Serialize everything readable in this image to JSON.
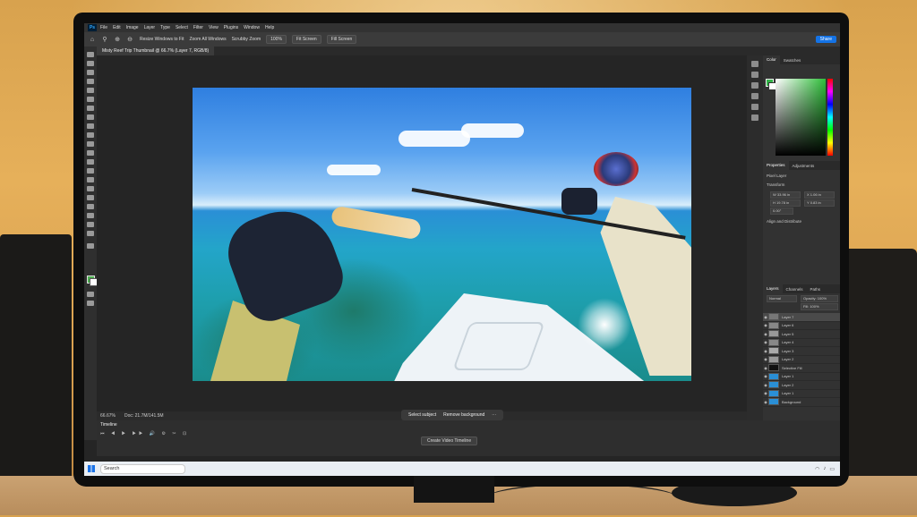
{
  "menu": {
    "logo": "Ps",
    "items": [
      "File",
      "Edit",
      "Image",
      "Layer",
      "Type",
      "Select",
      "Filter",
      "View",
      "Plugins",
      "Window",
      "Help"
    ]
  },
  "options": {
    "resize_windows": "Resize Windows to Fit",
    "zoom_all": "Zoom All Windows",
    "scrubby_zoom": "Scrubby Zoom",
    "zoom_value": "100%",
    "fit_screen": "Fit Screen",
    "fill_screen": "Fill Screen"
  },
  "document": {
    "tab_title": "Misty Reef Trip Thumbnail @ 66.7% (Layer 7, RGB/8)"
  },
  "share_button": "Share",
  "panels": {
    "color_tabs": [
      "Color",
      "Swatches"
    ],
    "properties_tabs": [
      "Properties",
      "Adjustments"
    ],
    "pixel_layer": "Pixel Layer",
    "transform_label": "Transform",
    "transform_values": [
      "W 33.96 in",
      "H 19.78 in",
      "X 1.06 in",
      "Y 0.83 in"
    ],
    "angle": "0.00°",
    "align_label": "Align and Distribute",
    "layers_tabs": [
      "Layers",
      "Channels",
      "Paths"
    ],
    "blend_mode": "Normal",
    "opacity": "Opacity: 100%",
    "fill": "Fill: 100%",
    "layers": [
      {
        "name": "Layer 7",
        "selected": true
      },
      {
        "name": "Layer 6",
        "selected": false
      },
      {
        "name": "Layer 5",
        "selected": false
      },
      {
        "name": "Layer 4",
        "selected": false
      },
      {
        "name": "Layer 3",
        "selected": false
      },
      {
        "name": "Layer 2",
        "selected": false
      },
      {
        "name": "Selective Fill",
        "selected": false
      },
      {
        "name": "Layer 1",
        "selected": false
      },
      {
        "name": "Layer 2",
        "selected": false
      },
      {
        "name": "Layer 1",
        "selected": false
      },
      {
        "name": "Background",
        "selected": false
      }
    ]
  },
  "status": {
    "zoom": "66.67%",
    "doc_size": "Doc: 21.7M/141.5M"
  },
  "contextual_bar": {
    "select_subject": "Select subject",
    "remove_background": "Remove background"
  },
  "timeline": {
    "tab": "Timeline",
    "create_button": "Create Video Timeline"
  },
  "taskbar": {
    "search_placeholder": "Search"
  },
  "colors": {
    "foreground": "#34b34a",
    "accent": "#1473e6"
  }
}
